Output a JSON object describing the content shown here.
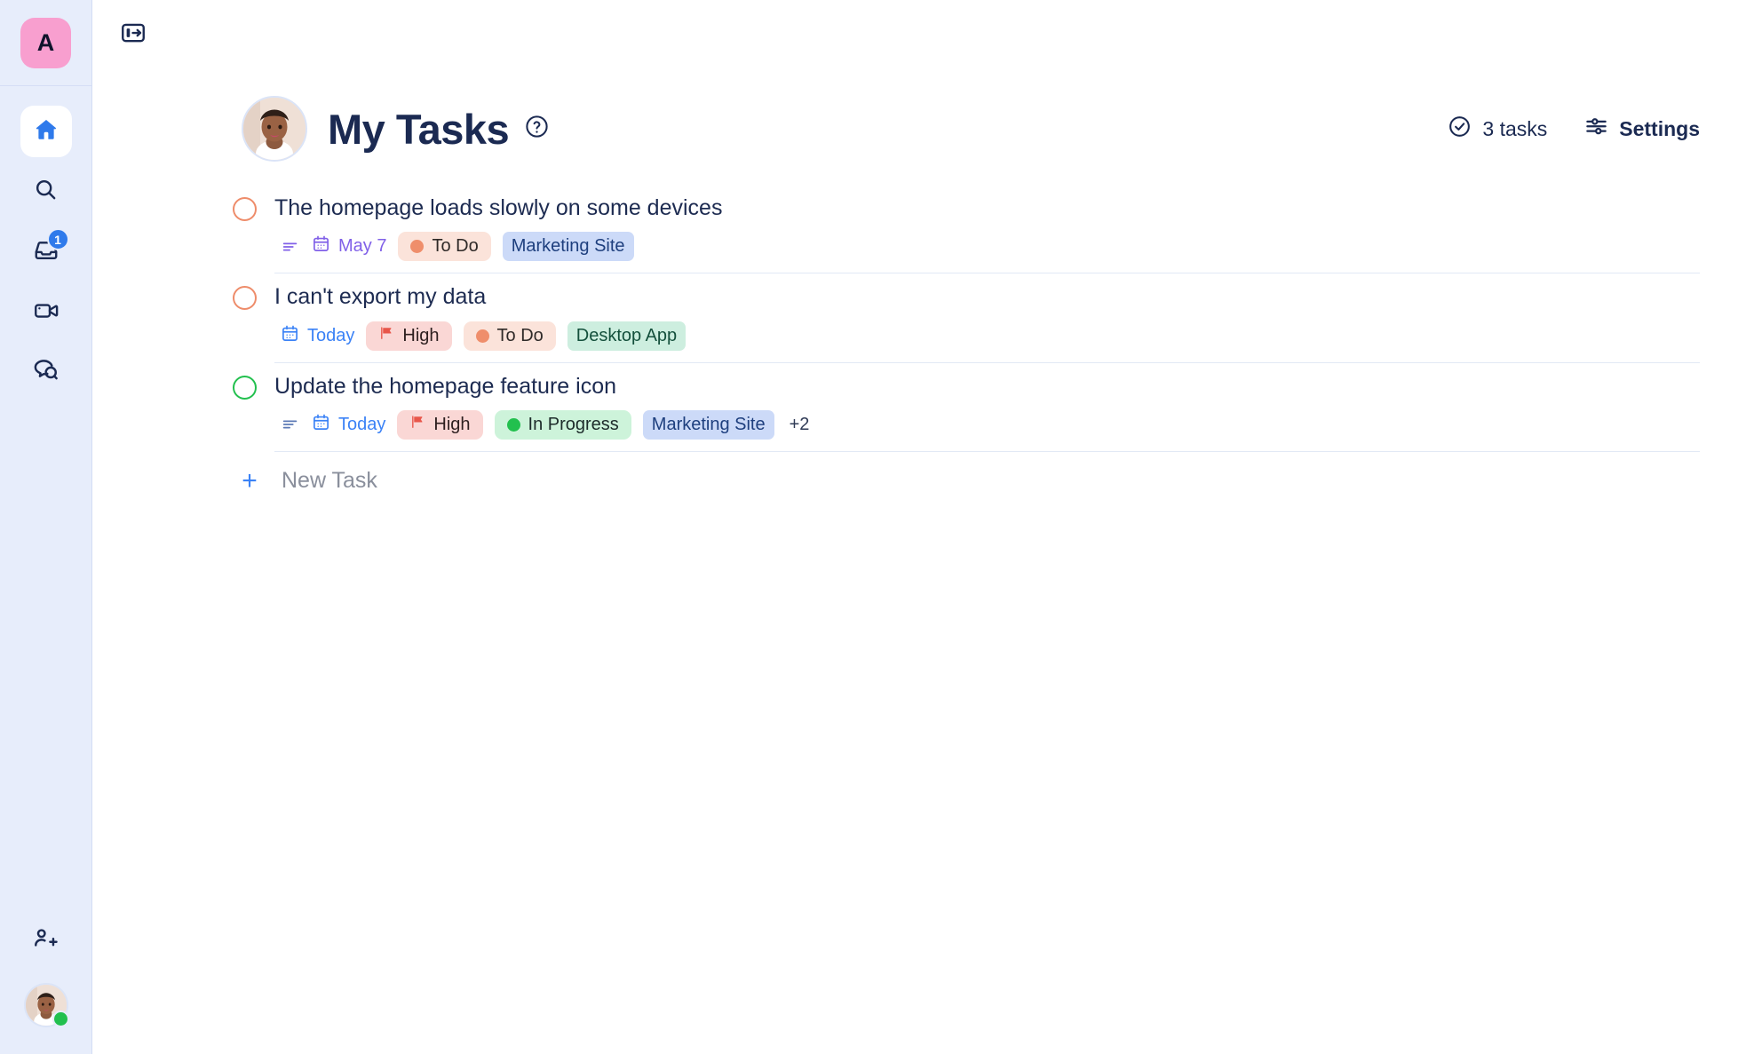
{
  "sidebar": {
    "workspace": {
      "initial": "A",
      "name": "workspace-avatar",
      "color": "#f89fcf"
    },
    "items": [
      {
        "icon": "home-icon",
        "name": "home",
        "active": true
      },
      {
        "icon": "search-icon",
        "name": "search",
        "active": false
      },
      {
        "icon": "inbox-icon",
        "name": "inbox",
        "active": false,
        "badge": "1"
      },
      {
        "icon": "video-camera-icon",
        "name": "recordings",
        "active": false
      },
      {
        "icon": "chat-search-icon",
        "name": "conversations",
        "active": false
      }
    ],
    "bottom": [
      {
        "icon": "add-people-icon",
        "name": "invite-people"
      },
      {
        "icon": "user-avatar",
        "name": "account",
        "status": "online"
      }
    ]
  },
  "topbar": {
    "collapse_icon": "panel-expand-icon"
  },
  "header": {
    "title": "My Tasks",
    "help_icon": "question-mark-circle-icon",
    "avatar_name": "header-user-avatar",
    "task_count": "3 tasks",
    "task_count_icon": "check-circle-icon",
    "settings_label": "Settings",
    "settings_icon": "sliders-icon"
  },
  "tasks": [
    {
      "title": "The homepage loads slowly on some devices",
      "checkbox_color": "#ee8c6a",
      "has_description": true,
      "description_icon_color": "#8161e8",
      "date": "May 7",
      "date_color": "purple",
      "priority": null,
      "status": "To Do",
      "status_type": "todo",
      "tag": "Marketing Site",
      "tag_type": "blue",
      "extra_tags": null
    },
    {
      "title": "I can't export my data",
      "checkbox_color": "#ee8c6a",
      "has_description": false,
      "description_icon_color": null,
      "date": "Today",
      "date_color": "blue",
      "priority": "High",
      "status": "To Do",
      "status_type": "todo",
      "tag": "Desktop App",
      "tag_type": "green",
      "extra_tags": null
    },
    {
      "title": "Update the homepage feature icon",
      "checkbox_color": "#22c04e",
      "has_description": true,
      "description_icon_color": "#5b79b5",
      "date": "Today",
      "date_color": "blue",
      "priority": "High",
      "status": "In Progress",
      "status_type": "progress",
      "tag": "Marketing Site",
      "tag_type": "blue",
      "extra_tags": "+2"
    }
  ],
  "new_task": {
    "label": "New Task",
    "plus": "+"
  },
  "colors": {
    "sidebar_bg": "#e7edfb",
    "accent_blue": "#3b82f6",
    "text_dark": "#1b2a52",
    "todo_orange": "#ef8e6b",
    "progress_green": "#22c04e",
    "high_red": "#e8564a"
  }
}
